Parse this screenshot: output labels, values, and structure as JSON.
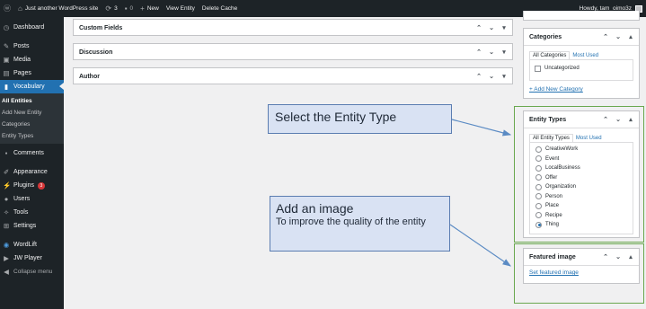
{
  "adminbar": {
    "site_name": "Just another WordPress site",
    "updates_count": "3",
    "comments_count": "0",
    "new_label": "New",
    "view_entity": "View Entity",
    "delete_cache": "Delete Cache",
    "howdy": "Howdy, tam_oimo3z"
  },
  "sidebar": {
    "dashboard": "Dashboard",
    "posts": "Posts",
    "media": "Media",
    "pages": "Pages",
    "vocabulary": "Vocabulary",
    "submenu": [
      "All Entities",
      "Add New Entity",
      "Categories",
      "Entity Types"
    ],
    "comments": "Comments",
    "appearance": "Appearance",
    "plugins": "Plugins",
    "plugins_badge": "3",
    "users": "Users",
    "tools": "Tools",
    "settings": "Settings",
    "wordlift": "WordLift",
    "jwplayer": "JW Player",
    "collapse": "Collapse menu"
  },
  "main": {
    "boxes": [
      "Custom Fields",
      "Discussion",
      "Author"
    ]
  },
  "categories": {
    "title": "Categories",
    "tab_all": "All Categories",
    "tab_used": "Most Used",
    "items": [
      "Uncategorized"
    ],
    "add_new": "+ Add New Category"
  },
  "entity_types": {
    "title": "Entity Types",
    "tab_all": "All Entity Types",
    "tab_used": "Most Used",
    "options": [
      "CreativeWork",
      "Event",
      "LocalBusiness",
      "Offer",
      "Organization",
      "Person",
      "Place",
      "Recipe",
      "Thing"
    ],
    "selected": "Thing"
  },
  "featured_image": {
    "title": "Featured image",
    "link": "Set featured image"
  },
  "callouts": {
    "entity_type": "Select the Entity Type",
    "image_title": "Add an image",
    "image_sub": "To improve the quality of the entity"
  },
  "colors": {
    "admin_dark": "#1d2327",
    "accent": "#2271b1",
    "highlight_green": "#6aa84f",
    "callout_fill": "#d9e2f3",
    "arrow": "#5b8bc4"
  }
}
